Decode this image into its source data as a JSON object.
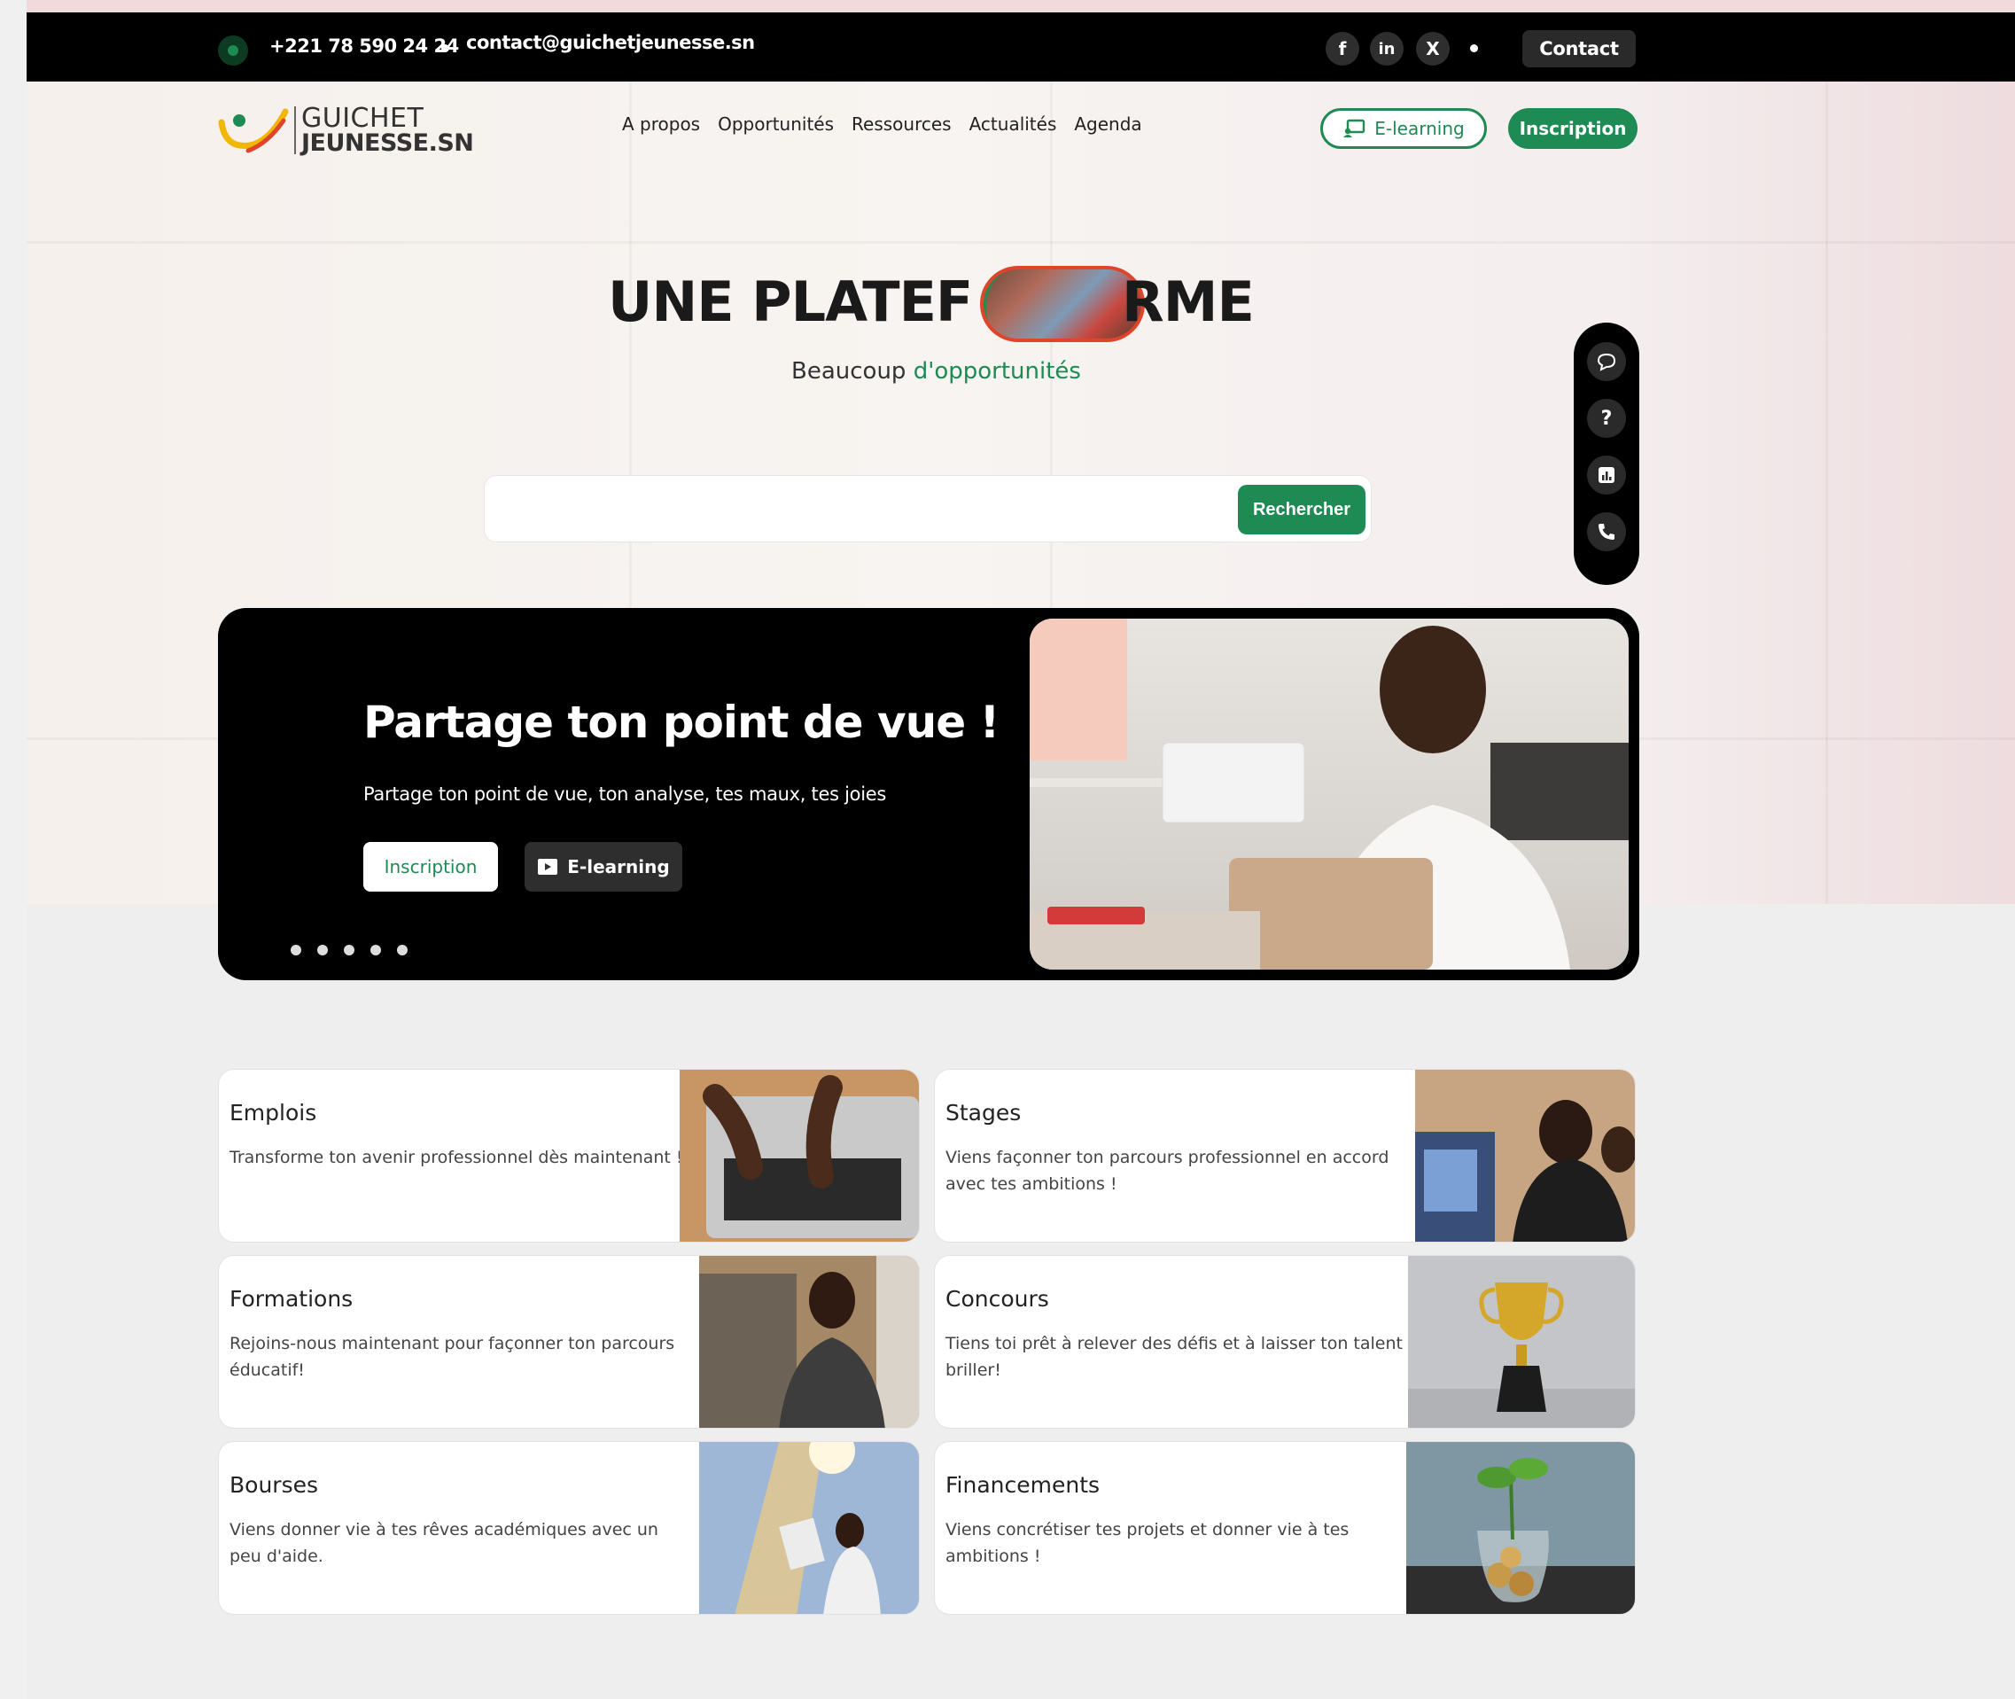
{
  "topbar": {
    "phone": "+221 78 590 24 24",
    "email": "contact@guichetjeunesse.sn",
    "social": [
      "f",
      "in",
      "X"
    ],
    "contact_label": "Contact"
  },
  "logo": {
    "line1": "GUICHET",
    "line2": "JEUNESSE.SN"
  },
  "nav": [
    "A propos",
    "Opportunités",
    "Ressources",
    "Actualités",
    "Agenda"
  ],
  "header_buttons": {
    "elearning": "E-learning",
    "inscription": "Inscription"
  },
  "hero": {
    "title_left": "UNE PLATEF",
    "title_right": "RME",
    "subtitle_plain": "Beaucoup",
    "subtitle_green": "d'opportunités"
  },
  "search": {
    "placeholder": "",
    "button": "Rechercher"
  },
  "floater_icons": [
    "chat-icon",
    "help-icon",
    "chart-icon",
    "phone-call-icon"
  ],
  "slider": {
    "title": "Partage ton point de vue !",
    "text": "Partage ton point de vue, ton analyse, tes maux, tes joies",
    "btn_inscription": "Inscription",
    "btn_elearning": "E-learning",
    "slides": 5
  },
  "cards": [
    {
      "title": "Emplois",
      "desc": "Transforme ton avenir professionnel dès maintenant !"
    },
    {
      "title": "Stages",
      "desc": "Viens façonner ton parcours professionnel en accord avec tes ambitions !"
    },
    {
      "title": "Formations",
      "desc": "Rejoins-nous maintenant pour façonner ton parcours éducatif!"
    },
    {
      "title": "Concours",
      "desc": "Tiens toi prêt à relever des défis et à laisser ton talent briller!"
    },
    {
      "title": "Bourses",
      "desc": "Viens donner vie à tes rêves académiques avec un peu d'aide."
    },
    {
      "title": "Financements",
      "desc": "Viens concrétiser tes projets et donner vie à tes ambitions !"
    }
  ],
  "colors": {
    "brand_green": "#1e8a54",
    "black": "#000000",
    "accent_red": "#e0442a",
    "accent_yellow": "#f2b705"
  }
}
